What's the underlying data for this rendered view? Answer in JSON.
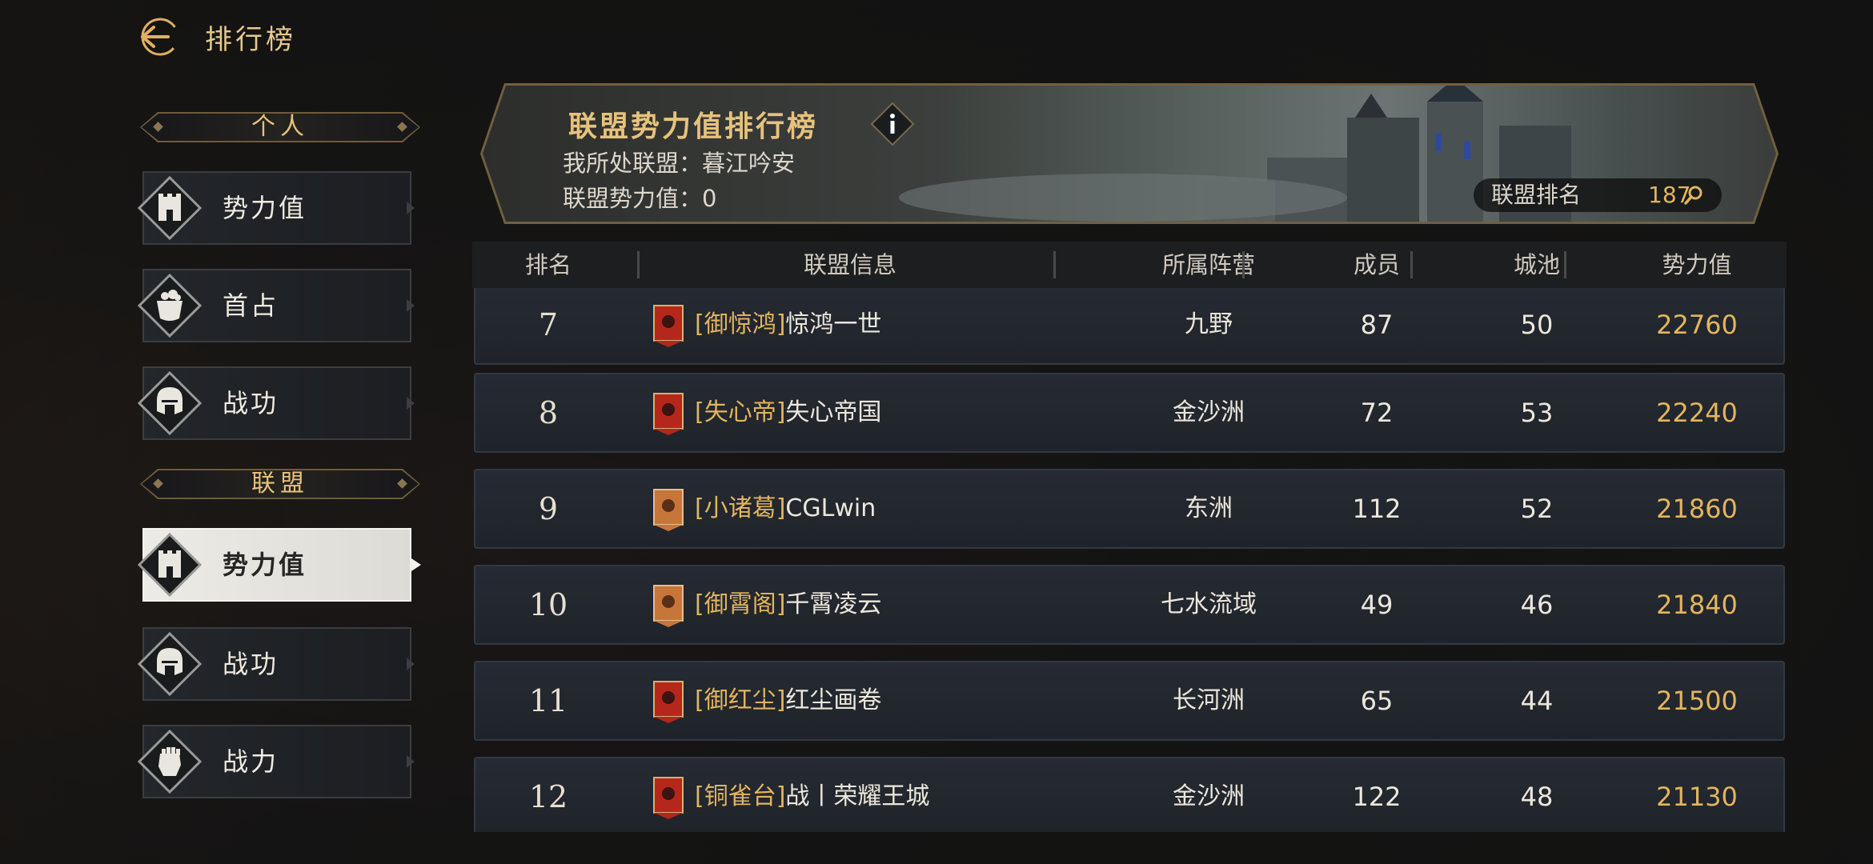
{
  "header": {
    "title": "排行榜",
    "back_icon": "back-arrow-icon"
  },
  "sidebar": {
    "sections": [
      {
        "label": "个人"
      },
      {
        "label": "联盟"
      }
    ],
    "personal_items": [
      {
        "label": "势力值",
        "icon": "castle-icon"
      },
      {
        "label": "首占",
        "icon": "treasure-pot-icon"
      },
      {
        "label": "战功",
        "icon": "helmet-icon"
      }
    ],
    "alliance_items": [
      {
        "label": "势力值",
        "icon": "castle-icon",
        "active": true
      },
      {
        "label": "战功",
        "icon": "helmet-icon"
      },
      {
        "label": "战力",
        "icon": "fist-icon"
      }
    ]
  },
  "banner": {
    "title": "联盟势力值排行榜",
    "info_icon": "info-icon",
    "my_alliance_label": "我所处联盟：",
    "my_alliance_value": "暮江吟安",
    "alliance_power_label": "联盟势力值：",
    "alliance_power_value": "0",
    "rank_label": "联盟排名",
    "rank_value": "187",
    "search_icon": "magnifier-icon"
  },
  "table": {
    "columns": [
      "排名",
      "联盟信息",
      "所属阵营",
      "成员",
      "城池",
      "势力值"
    ],
    "rows": [
      {
        "rank": "7",
        "tag": "[御惊鸿]",
        "name": "惊鸿一世",
        "flag": "red",
        "camp": "九野",
        "members": "87",
        "cities": "50",
        "power": "22760"
      },
      {
        "rank": "8",
        "tag": "[失心帝]",
        "name": "失心帝国",
        "flag": "red",
        "camp": "金沙洲",
        "members": "72",
        "cities": "53",
        "power": "22240"
      },
      {
        "rank": "9",
        "tag": "[小诸葛]",
        "name": "CGLwin",
        "flag": "orange",
        "camp": "东洲",
        "members": "112",
        "cities": "52",
        "power": "21860"
      },
      {
        "rank": "10",
        "tag": "[御霄阁]",
        "name": "千霄凌云",
        "flag": "orange",
        "camp": "七水流域",
        "members": "49",
        "cities": "46",
        "power": "21840"
      },
      {
        "rank": "11",
        "tag": "[御红尘]",
        "name": "红尘画卷",
        "flag": "red",
        "camp": "长河洲",
        "members": "65",
        "cities": "44",
        "power": "21500"
      },
      {
        "rank": "12",
        "tag": "[铜雀台]",
        "name": "战丨荣耀王城",
        "flag": "red",
        "camp": "金沙洲",
        "members": "122",
        "cities": "48",
        "power": "21130"
      }
    ]
  },
  "colors": {
    "gold": "#e2b55e",
    "title_gold": "#e6c27c",
    "flag_red": "#b5261d",
    "flag_orange": "#c7763a"
  }
}
